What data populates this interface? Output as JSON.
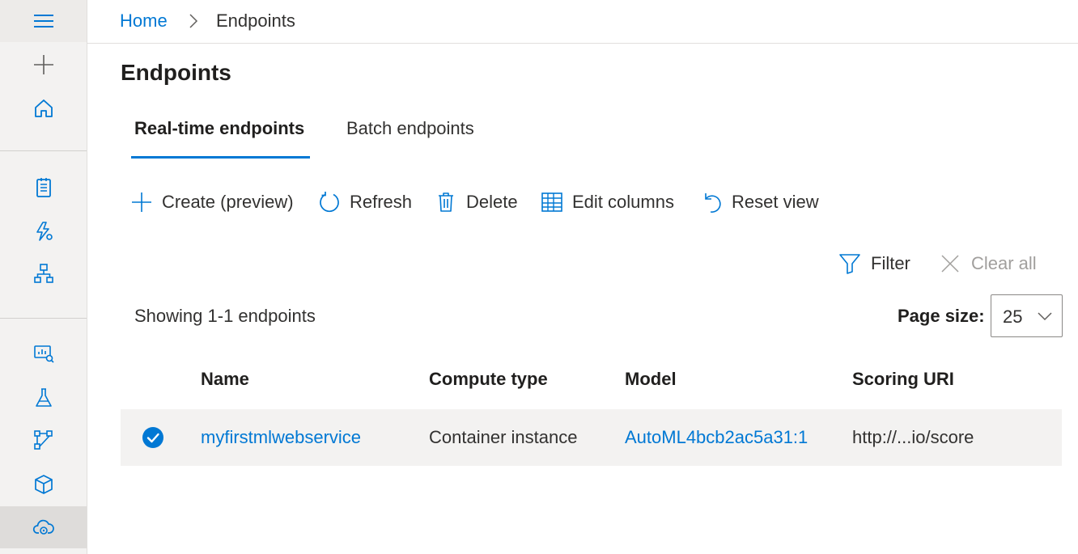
{
  "breadcrumb": {
    "home": "Home",
    "current": "Endpoints"
  },
  "page_title": "Endpoints",
  "tabs": [
    {
      "label": "Real-time endpoints",
      "selected": true
    },
    {
      "label": "Batch endpoints",
      "selected": false
    }
  ],
  "toolbar": {
    "create": "Create (preview)",
    "refresh": "Refresh",
    "delete": "Delete",
    "edit_columns": "Edit columns",
    "reset_view": "Reset view"
  },
  "filter": {
    "filter_label": "Filter",
    "clear_all_label": "Clear all"
  },
  "summary": "Showing 1-1 endpoints",
  "page_size": {
    "label": "Page size:",
    "value": "25"
  },
  "table": {
    "columns": [
      "Name",
      "Compute type",
      "Model",
      "Scoring URI"
    ],
    "rows": [
      {
        "selected": true,
        "name": "myfirstmlwebservice",
        "compute_type": "Container instance",
        "model": "AutoML4bcb2ac5a31:1",
        "scoring_uri": "http://...io/score"
      }
    ]
  },
  "colors": {
    "accent": "#0078d4",
    "rail_bg": "#f3f2f1",
    "row_bg": "#f3f2f1",
    "disabled": "#a19f9d"
  },
  "sidebar_icons": [
    "hamburger-icon",
    "plus-icon",
    "home-icon",
    "notebook-icon",
    "automl-icon",
    "designer-icon",
    "datasets-icon",
    "experiments-icon",
    "pipelines-icon",
    "models-icon",
    "endpoints-icon"
  ]
}
